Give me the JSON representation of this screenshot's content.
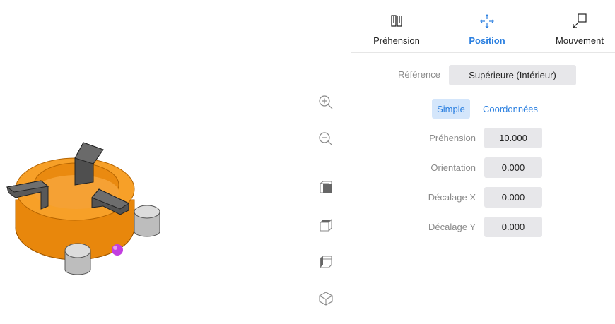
{
  "tabs": [
    {
      "label": "Préhension",
      "icon": "gripper-icon",
      "active": false
    },
    {
      "label": "Position",
      "icon": "move-arrows-icon",
      "active": true
    },
    {
      "label": "Mouvement",
      "icon": "movement-icon",
      "active": false
    }
  ],
  "reference": {
    "label": "Référence",
    "value": "Supérieure (Intérieur)"
  },
  "modes": {
    "simple": "Simple",
    "coordinates": "Coordonnées",
    "active": "Simple"
  },
  "fields": [
    {
      "label": "Préhension",
      "value": "10.000"
    },
    {
      "label": "Orientation",
      "value": "0.000"
    },
    {
      "label": "Décalage X",
      "value": "0.000"
    },
    {
      "label": "Décalage Y",
      "value": "0.000"
    }
  ],
  "toolbar": [
    "zoom-in-icon",
    "zoom-out-icon",
    "view-front-icon",
    "view-top-icon",
    "view-side-icon",
    "view-iso-icon"
  ],
  "colors": {
    "accent": "#2a7fe0",
    "part": "#f39a12",
    "gripper": "#4a4a4a",
    "marker": "#c23ee0"
  }
}
